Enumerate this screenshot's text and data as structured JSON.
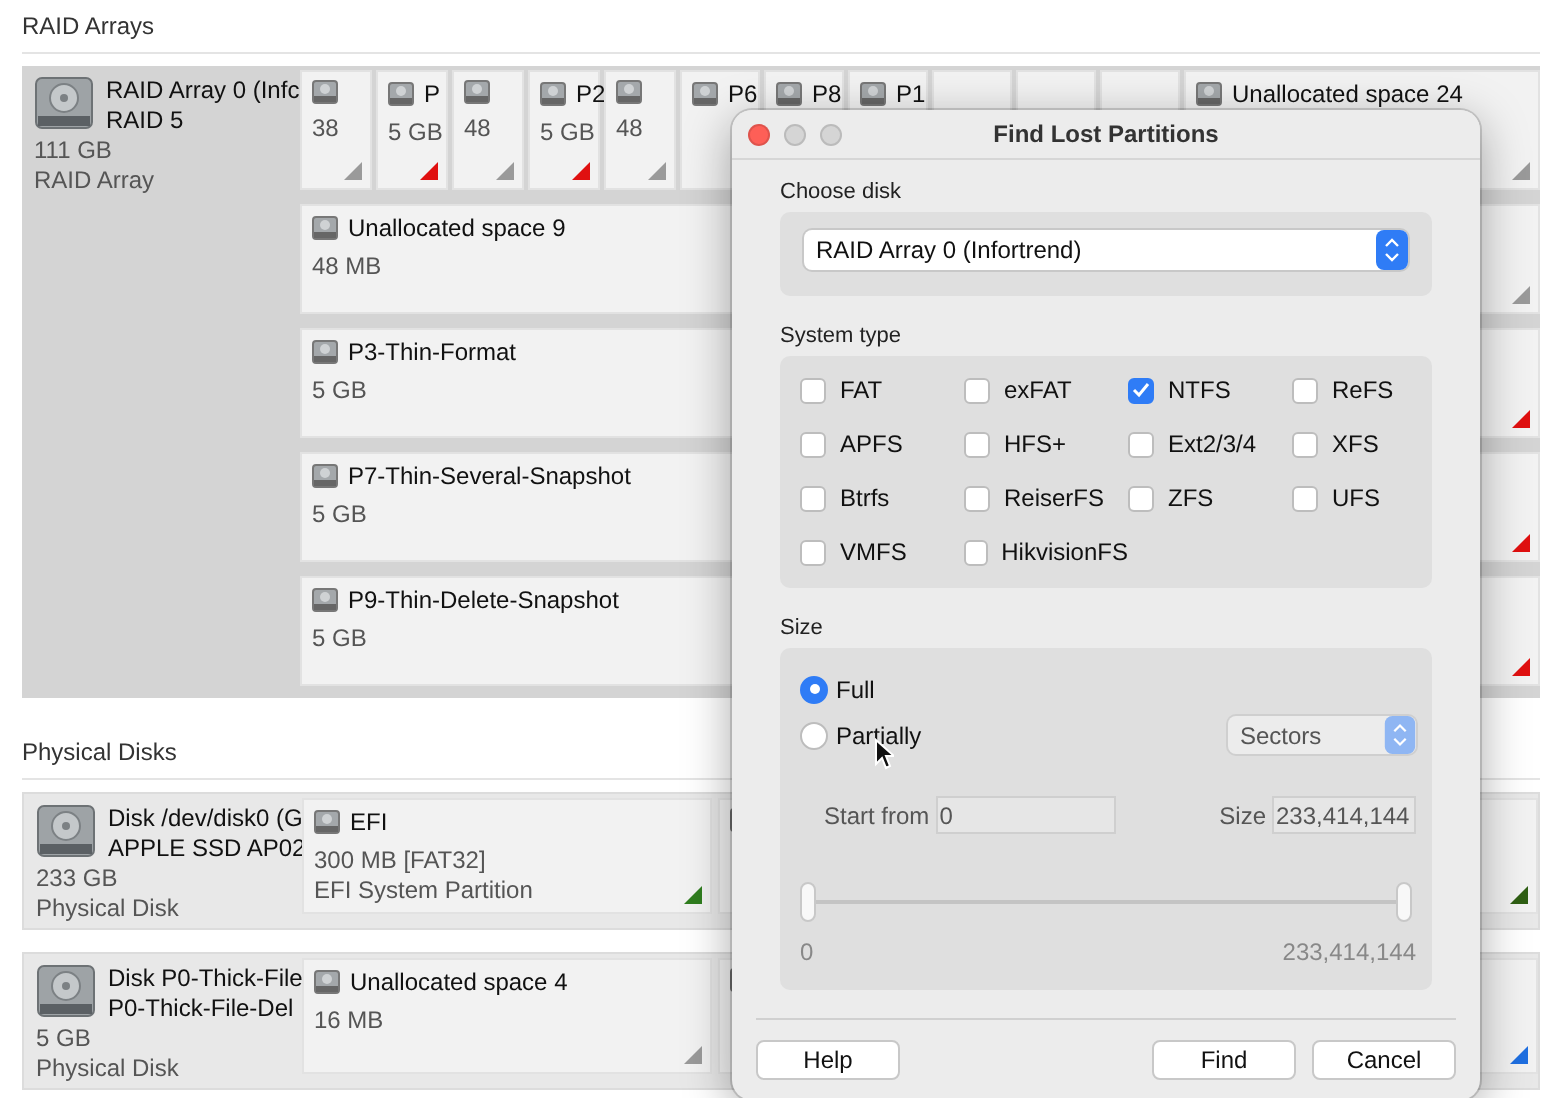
{
  "sections": [
    {
      "title": "RAID Arrays",
      "kind": "raid",
      "disks": [
        {
          "name": "RAID Array 0 (Infc",
          "model": "RAID 5",
          "size": "111 GB",
          "type": "RAID Array",
          "strip": [
            {
              "kind": "partition",
              "size": "38",
              "color": "#9a9a9a"
            },
            {
              "kind": "partition",
              "name": "P",
              "size": "5 GB",
              "color": "#e01010"
            },
            {
              "kind": "partition",
              "size": "48",
              "color": "#9a9a9a"
            },
            {
              "kind": "partition",
              "name": "P2",
              "size": "5 GB",
              "color": "#e01010"
            },
            {
              "kind": "partition",
              "size": "48",
              "color": "#9a9a9a"
            },
            {
              "kind": "partition",
              "name": "P6"
            },
            {
              "kind": "partition",
              "name": "P8"
            },
            {
              "kind": "partition",
              "name": "P1"
            },
            {
              "kind": "partition"
            },
            {
              "kind": "partition"
            },
            {
              "kind": "partition"
            },
            {
              "kind": "partition",
              "name": "Unallocated space 24",
              "color": "#9a9a9a"
            }
          ],
          "partitions": [
            {
              "name": "Unallocated space 9",
              "size": "48 MB",
              "color": "#9a9a9a"
            },
            {
              "name": "P3-Thin-Format",
              "size": "5 GB",
              "color": "#e01010"
            },
            {
              "name": "P7-Thin-Several-Snapshot",
              "size": "5 GB",
              "color": "#e01010"
            },
            {
              "name": "P9-Thin-Delete-Snapshot",
              "size": "5 GB",
              "color": "#e01010"
            }
          ]
        }
      ]
    },
    {
      "title": "Physical Disks",
      "kind": "physical",
      "disks": [
        {
          "name": "Disk /dev/disk0 (G",
          "model": "APPLE SSD AP02",
          "size": "233 GB",
          "type": "Physical Disk",
          "partitions": [
            {
              "name": "EFI",
              "size": "300 MB [FAT32]",
              "description": "EFI System Partition",
              "color": "#2f7d1e"
            },
            {
              "color": "#2f5f14"
            }
          ]
        },
        {
          "name": "Disk P0-Thick-File",
          "model": "P0-Thick-File-Del",
          "size": "5 GB",
          "type": "Physical Disk",
          "partitions": [
            {
              "name": "Unallocated space 4",
              "size": "16 MB",
              "color": "#9a9a9a"
            },
            {
              "color": "#1f6fe0"
            }
          ]
        }
      ]
    }
  ],
  "dialog": {
    "title": "Find Lost Partitions",
    "choose_disk": {
      "label": "Choose disk",
      "value": "RAID Array 0 (Infortrend)"
    },
    "system_type": {
      "label": "System type",
      "options": [
        {
          "label": "FAT",
          "checked": false
        },
        {
          "label": "exFAT",
          "checked": false
        },
        {
          "label": "NTFS",
          "checked": true
        },
        {
          "label": "ReFS",
          "checked": false
        },
        {
          "label": "APFS",
          "checked": false
        },
        {
          "label": "HFS+",
          "checked": false
        },
        {
          "label": "Ext2/3/4",
          "checked": false
        },
        {
          "label": "XFS",
          "checked": false
        },
        {
          "label": "Btrfs",
          "checked": false
        },
        {
          "label": "ReiserFS",
          "checked": false
        },
        {
          "label": "ZFS",
          "checked": false
        },
        {
          "label": "UFS",
          "checked": false
        },
        {
          "label": "VMFS",
          "checked": false
        },
        {
          "label": "HikvisionFS",
          "checked": false
        }
      ]
    },
    "size": {
      "label": "Size",
      "modes": [
        {
          "label": "Full",
          "selected": true
        },
        {
          "label": "Partially",
          "selected": false
        }
      ],
      "unit": "Sectors",
      "start_label": "Start from",
      "start_value": "0",
      "size_label": "Size",
      "size_value": "233,414,144",
      "thumbs": [
        {
          "level": 0
        },
        {
          "level": 1
        }
      ],
      "min_label": "0",
      "max_label": "233,414,144"
    },
    "buttons": [
      {
        "label": "Help",
        "kind": "left"
      },
      {
        "label": "Find",
        "kind": "right"
      },
      {
        "label": "Cancel",
        "kind": "right"
      }
    ]
  }
}
